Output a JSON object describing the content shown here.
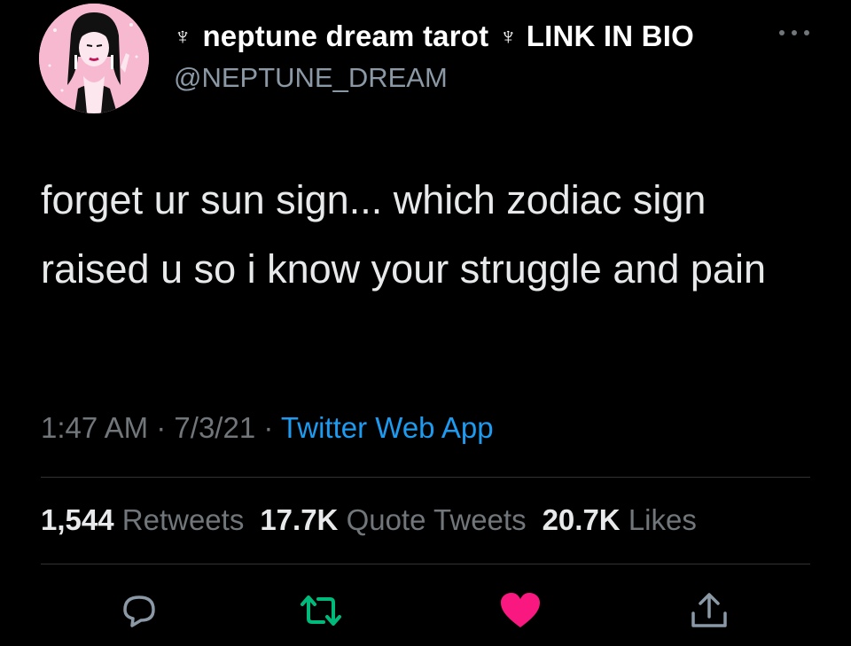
{
  "user": {
    "name_symbol": "♆",
    "name": "neptune dream tarot",
    "bio_link": "LINK IN BIO",
    "handle": "@NEPTUNE_DREAM"
  },
  "tweet": {
    "text": "forget ur sun sign... which zodiac sign raised u so i know your struggle and pain"
  },
  "meta": {
    "time": "1:47 AM",
    "separator": "·",
    "date": "7/3/21",
    "app": "Twitter Web App"
  },
  "stats": {
    "retweets_count": "1,544",
    "retweets_label": "Retweets",
    "quotes_count": "17.7K",
    "quotes_label": "Quote Tweets",
    "likes_count": "20.7K",
    "likes_label": "Likes"
  },
  "actions": {
    "reply_icon": "reply-icon",
    "retweet_icon": "retweet-icon",
    "like_icon": "heart-icon",
    "share_icon": "share-icon"
  },
  "colors": {
    "background": "#000000",
    "text": "#e7e9ea",
    "secondary": "#71767b",
    "link": "#1d9bf0",
    "retweet_active": "#00ba7c",
    "like_active": "#f91880",
    "avatar_pink": "#f7b9d0"
  }
}
